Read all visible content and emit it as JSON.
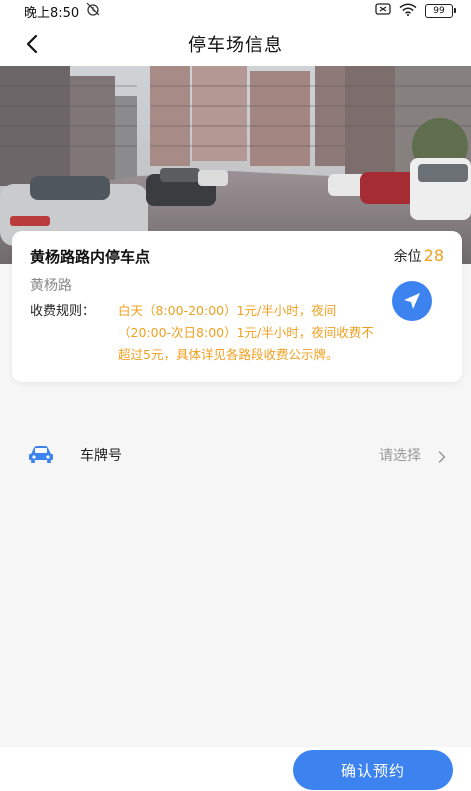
{
  "status_bar": {
    "time": "晚上8:50",
    "battery": "99"
  },
  "nav": {
    "title": "停车场信息"
  },
  "lot": {
    "name": "黄杨路路内停车点",
    "remaining_label": "余位",
    "remaining_count": "28",
    "road": "黄杨路",
    "fee_label": "收费规则：",
    "fee_text": "白天（8:00-20:00）1元/半小时，夜间（20:00-次日8:00）1元/半小时，夜间收费不超过5元，具体详见各路段收费公示牌。"
  },
  "plate": {
    "label": "车牌号",
    "placeholder": "请选择"
  },
  "actions": {
    "confirm": "确认预约"
  },
  "colors": {
    "accent": "#3d83f0",
    "highlight": "#f0a020"
  }
}
